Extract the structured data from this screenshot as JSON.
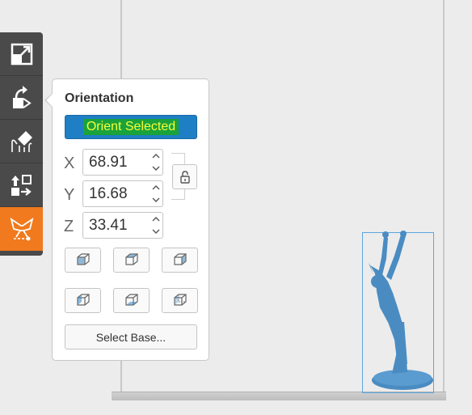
{
  "panel": {
    "title": "Orientation",
    "orient_button": "Orient Selected",
    "fields": [
      {
        "axis": "X",
        "value": "68.91"
      },
      {
        "axis": "Y",
        "value": "16.68"
      },
      {
        "axis": "Z",
        "value": "33.41"
      }
    ],
    "select_base": "Select Base..."
  },
  "toolbar": {
    "tools": [
      "scale-icon",
      "rotate-icon",
      "support-icon",
      "arrange-icon",
      "mirror-icon"
    ],
    "active_tool": "mirror-icon"
  },
  "colors": {
    "accent": "#f07a1d",
    "toolbar": "#4a4a4a",
    "button": "#1f7fc4",
    "model": "#4a8cc2"
  }
}
